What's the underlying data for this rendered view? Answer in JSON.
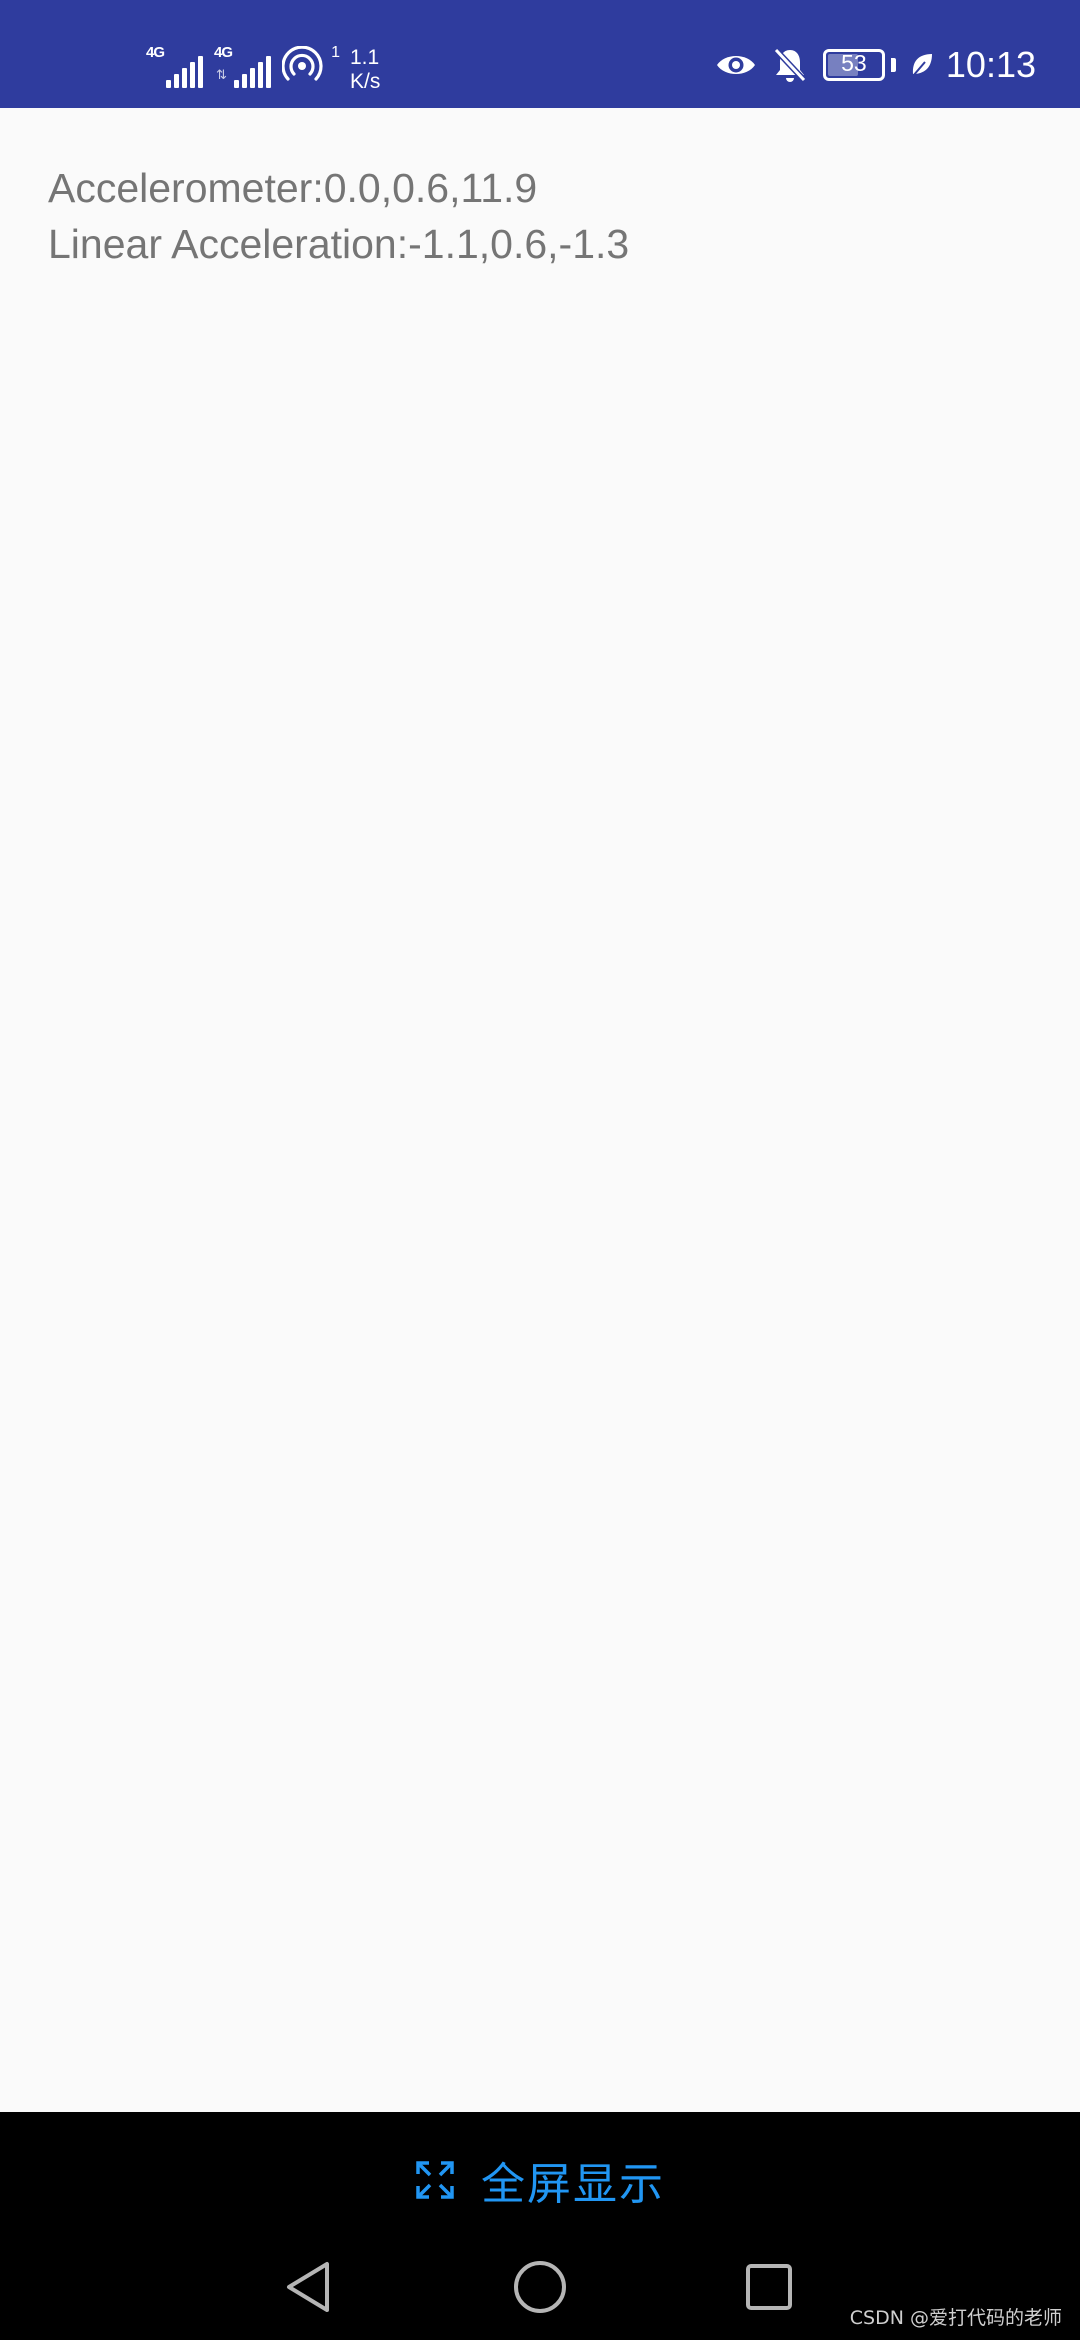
{
  "status_bar": {
    "background": "#2f3c9e",
    "sim1_network": "4G",
    "sim2_network": "4G",
    "hotspot_count": "1",
    "speed_value": "1.1",
    "speed_unit": "K/s",
    "battery_level": "53",
    "time": "10:13",
    "icons": [
      "signal-icon",
      "signal-icon",
      "hotspot-icon",
      "eye-icon",
      "bell-muted-icon",
      "battery-icon",
      "leaf-icon"
    ]
  },
  "sensors": {
    "accelerometer": "Accelerometer:0.0,0.6,11.9",
    "linear_acceleration": "Linear Acceleration:-1.1,0.6,-1.3"
  },
  "bottom": {
    "fullscreen_label": "全屏显示",
    "accent": "#2196f3",
    "nav_icons": [
      "back-icon",
      "home-icon",
      "recents-icon"
    ]
  },
  "watermark": "CSDN @爱打代码的老师"
}
